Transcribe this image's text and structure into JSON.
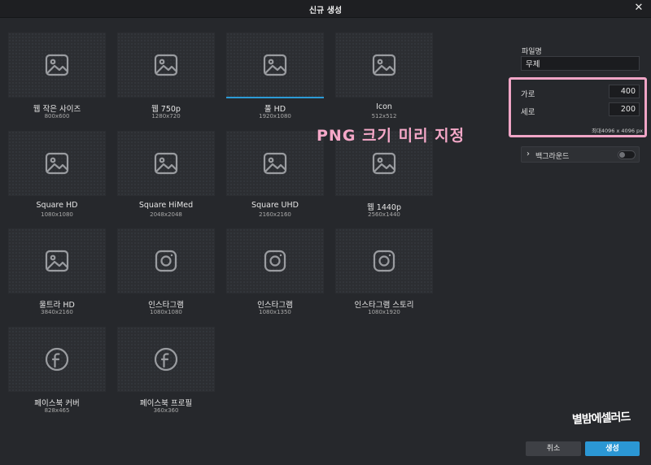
{
  "dialog": {
    "title": "신규 생성"
  },
  "presets": [
    {
      "label": "웹 작은 사이즈",
      "dims": "800x600",
      "icon": "image"
    },
    {
      "label": "웹 750p",
      "dims": "1280x720",
      "icon": "image"
    },
    {
      "label": "풀 HD",
      "dims": "1920x1080",
      "icon": "image",
      "selected": true
    },
    {
      "label": "Icon",
      "dims": "512x512",
      "icon": "image"
    },
    {
      "label": "Square HD",
      "dims": "1080x1080",
      "icon": "image"
    },
    {
      "label": "Square HiMed",
      "dims": "2048x2048",
      "icon": "image"
    },
    {
      "label": "Square UHD",
      "dims": "2160x2160",
      "icon": "image"
    },
    {
      "label": "웹 1440p",
      "dims": "2560x1440",
      "icon": "image"
    },
    {
      "label": "울트라 HD",
      "dims": "3840x2160",
      "icon": "image"
    },
    {
      "label": "인스타그램",
      "dims": "1080x1080",
      "icon": "instagram"
    },
    {
      "label": "인스타그램",
      "dims": "1080x1350",
      "icon": "instagram"
    },
    {
      "label": "인스타그램 스토리",
      "dims": "1080x1920",
      "icon": "instagram"
    },
    {
      "label": "페이스북 커버",
      "dims": "828x465",
      "icon": "facebook"
    },
    {
      "label": "페이스북 프로필",
      "dims": "360x360",
      "icon": "facebook"
    }
  ],
  "panel": {
    "filename_label": "파일명",
    "filename_value": "무제",
    "width_label": "가로",
    "width_value": "400",
    "height_label": "세로",
    "height_value": "200",
    "max_note": "최대4096 x 4096 px",
    "background_label": "백그라운드",
    "background_enabled": false
  },
  "annotation": "PNG 크기 미리 지정",
  "watermark": "별밤에셀러드",
  "buttons": {
    "cancel": "취소",
    "create": "생성"
  },
  "colors": {
    "accent": "#2b97d4",
    "highlight": "#f0a5c6",
    "background": "#26282c"
  }
}
